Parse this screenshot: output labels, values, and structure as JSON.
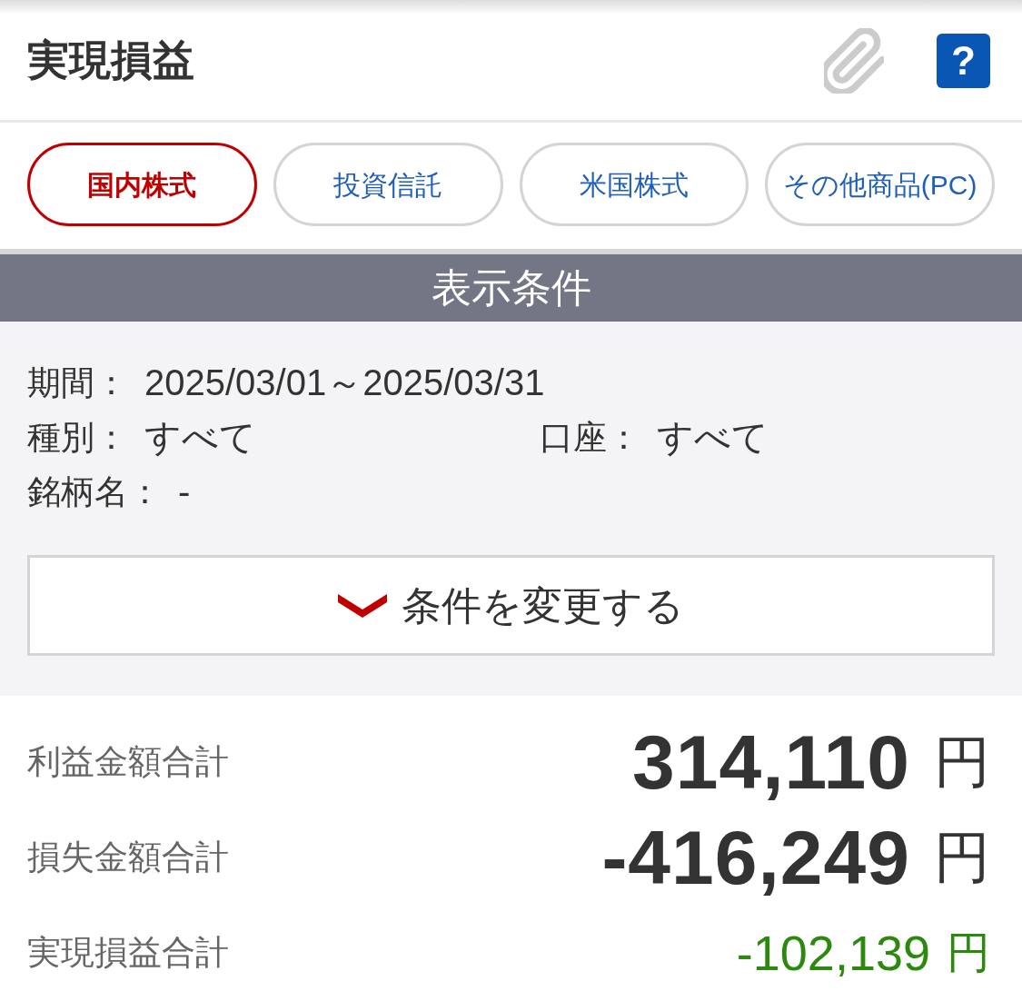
{
  "header": {
    "title": "実現損益",
    "help_button": {
      "label": "?"
    }
  },
  "tabs": [
    {
      "label": "国内株式",
      "selected": true
    },
    {
      "label": "投資信託",
      "selected": false
    },
    {
      "label": "米国株式",
      "selected": false
    },
    {
      "label": "その他商品(PC)",
      "selected": false
    }
  ],
  "conditions": {
    "title": "表示条件",
    "rows": [
      [
        {
          "label": "期間：",
          "value": "2025/03/01～2025/03/31"
        }
      ],
      [
        {
          "label": "種別：",
          "value": "すべて"
        },
        {
          "label": "口座：",
          "value": "すべて"
        }
      ],
      [
        {
          "label": "銘柄名：",
          "value": "-"
        }
      ]
    ],
    "change_button": {
      "label": "条件を変更する"
    }
  },
  "totals": [
    {
      "kind": "large",
      "label": "利益金額合計",
      "amount": "314,110",
      "unit": "円"
    },
    {
      "kind": "large",
      "label": "損失金額合計",
      "amount": "-416,249",
      "unit": "円"
    },
    {
      "kind": "net",
      "label": "実現損益合計",
      "amount": "-102,139",
      "unit": "円"
    }
  ]
}
